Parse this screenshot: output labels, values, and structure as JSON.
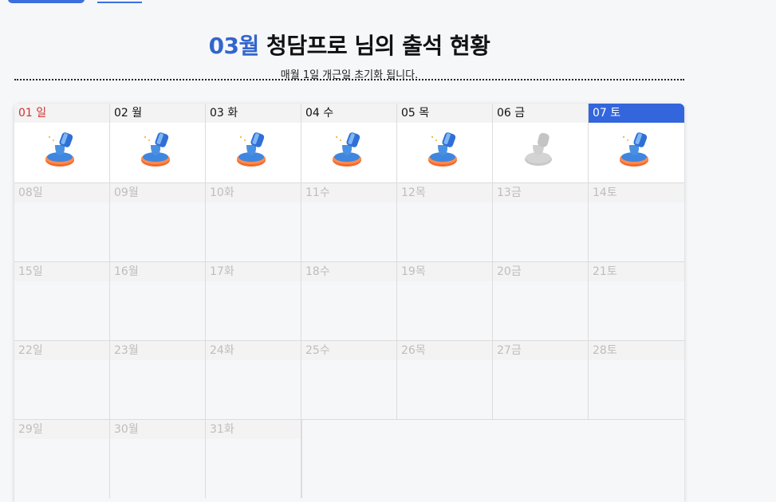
{
  "header": {
    "month": "03월",
    "title_rest": " 청담프로 님의 출석 현황",
    "subtitle": "매월 1일 개근일 초기화 됩니다."
  },
  "week1": [
    {
      "label": "01 일",
      "stamped": true
    },
    {
      "label": "02 월",
      "stamped": true
    },
    {
      "label": "03 화",
      "stamped": true
    },
    {
      "label": "04 수",
      "stamped": true
    },
    {
      "label": "05 목",
      "stamped": true
    },
    {
      "label": "06 금",
      "stamped": false
    },
    {
      "label": "07 토",
      "stamped": true
    }
  ],
  "week2": [
    "08일",
    "09월",
    "10화",
    "11수",
    "12목",
    "13금",
    "14토"
  ],
  "week3": [
    "15일",
    "16월",
    "17화",
    "18수",
    "19목",
    "20금",
    "21토"
  ],
  "week4": [
    "22일",
    "23월",
    "24화",
    "25수",
    "26목",
    "27금",
    "28토"
  ],
  "week5": [
    "29일",
    "30월",
    "31화"
  ],
  "colors": {
    "accent": "#3366dd",
    "sunday": "#d23030",
    "stamp_orange": "#f26a2e",
    "stamp_blue": "#4a90e2"
  }
}
